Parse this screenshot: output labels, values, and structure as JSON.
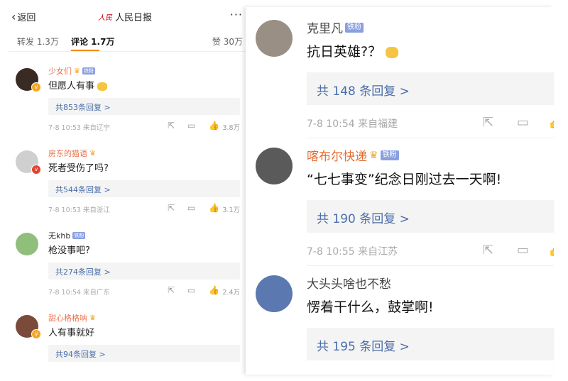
{
  "left": {
    "back_label": "返回",
    "brand_logo": "人民",
    "brand_name": "人民日报",
    "more": "···",
    "tabs": {
      "repost": "转发 1.3万",
      "comment": "评论 1.7万",
      "like": "赞 30万"
    },
    "comments": [
      {
        "name": "少女们",
        "badge": "铁粉",
        "text": "但愿人有事",
        "reply": "共853条回复 >",
        "time": "7-8 10:53 来自辽宁",
        "likes": "3.8万",
        "avatar_color": "#3a2a24"
      },
      {
        "name": "房东的猫语",
        "badge": "",
        "text": "死者受伤了吗?",
        "reply": "共544条回复 >",
        "time": "7-8 10:53 来自浙江",
        "likes": "3.1万",
        "avatar_color": "#cfcfcf"
      },
      {
        "name": "无khb",
        "badge": "铁粉",
        "text": "枪没事吧?",
        "reply": "共274条回复 >",
        "time": "7-8 10:54 来自广东",
        "likes": "2.4万",
        "avatar_color": "#8fbf7a"
      },
      {
        "name": "甜心格格呐",
        "badge": "",
        "text": "人有事就好",
        "reply": "共94条回复 >",
        "time": "",
        "likes": "",
        "avatar_color": "#7a4a3a"
      }
    ]
  },
  "right": {
    "comments": [
      {
        "name": "克里凡",
        "badge": "铁粉",
        "text": "抗日英雄?？",
        "reply": "共 148 条回复 >",
        "time": "7-8 10:54 来自福建",
        "avatar_color": "#9a8f84"
      },
      {
        "name": "喀布尔快递",
        "badge": "铁粉",
        "text": "“七七事变”纪念日刚过去一天啊!",
        "reply": "共 190 条回复 >",
        "time": "7-8 10:55 来自江苏",
        "avatar_color": "#5a5a5a"
      },
      {
        "name": "大头头啥也不愁",
        "badge": "",
        "text": "愣着干什么，鼓掌啊!",
        "reply": "共 195 条回复 >",
        "time": "",
        "avatar_color": "#5b78b0"
      }
    ]
  },
  "icons": {
    "share": "share-icon",
    "comment": "comment-icon",
    "like": "like-icon"
  }
}
